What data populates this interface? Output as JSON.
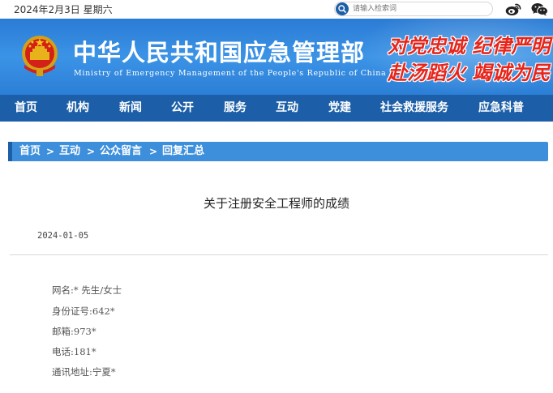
{
  "topbar": {
    "date": "2024年2月3日 星期六",
    "search_placeholder": "请输入检索词"
  },
  "header": {
    "title": "中华人民共和国应急管理部",
    "subtitle": "Ministry of Emergency Management of the People's Republic of China",
    "slogan_line1": "对党忠诚 纪律严明",
    "slogan_line2": "赴汤蹈火 竭诚为民"
  },
  "nav": {
    "items": [
      "首页",
      "机构",
      "新闻",
      "公开",
      "服务",
      "互动",
      "党建",
      "社会救援服务",
      "应急科普"
    ]
  },
  "breadcrumb": {
    "items": [
      "首页",
      "互动",
      "公众留言",
      "回复汇总"
    ],
    "separator": ">"
  },
  "article": {
    "title": "关于注册安全工程师的成绩",
    "date": "2024-01-05",
    "fields": [
      "网名:* 先生/女士",
      "身份证号:642*",
      "邮箱:973*",
      "电话:181*",
      "通讯地址:宁夏*"
    ]
  },
  "colors": {
    "nav_bg": "#1c5fa8",
    "banner_blue": "#3b93e6",
    "breadcrumb_bg": "#3d8fdc",
    "slogan_red": "#e6251b"
  }
}
